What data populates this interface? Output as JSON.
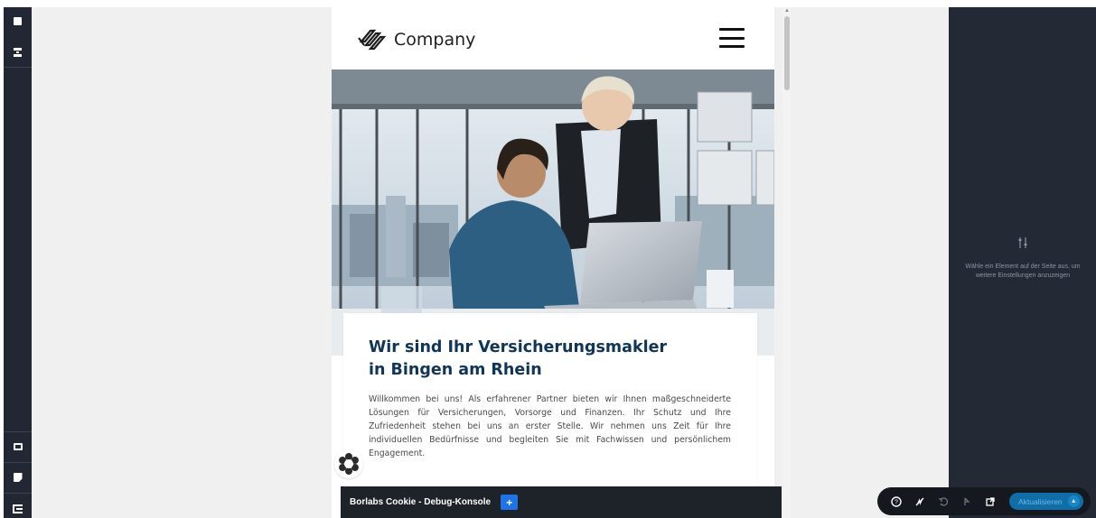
{
  "left_toolbar": {
    "items": [
      "structure-icon",
      "layout-icon",
      "desktop-preview-icon",
      "notes-icon",
      "exit-builder-icon"
    ]
  },
  "site": {
    "logo_text": "Company",
    "card": {
      "title_line1": "Wir sind Ihr Versicherungsmakler",
      "title_line2": "in Bingen am Rhein",
      "body": "Willkommen bei uns! Als erfahrener Partner bieten wir Ihnen maßgeschneiderte Lösungen für Versicherungen, Vorsorge und Finanzen. Ihr Schutz und Ihre Zufriedenheit stehen bei uns an erster Stelle. Wir nehmen uns Zeit für Ihre individuellen Bedürfnisse und begleiten Sie mit Fachwissen und persönlichem Engagement."
    }
  },
  "debug_console": {
    "label": "Borlabs Cookie - Debug-Konsole",
    "plus": "+"
  },
  "right_panel": {
    "hint": "Wähle ein Element auf der Seite aus, um weitere Einstellungen anzuzeigen"
  },
  "actions": {
    "update_label": "Aktualisieren",
    "icons": [
      "help-icon",
      "disable-icon",
      "undo-icon",
      "history-icon",
      "external-link-icon"
    ]
  },
  "colors": {
    "builder_dark": "#242936",
    "heading_navy": "#0f3558",
    "debug_plus_blue": "#1e73e8",
    "update_blue": "#0f6ea8"
  }
}
